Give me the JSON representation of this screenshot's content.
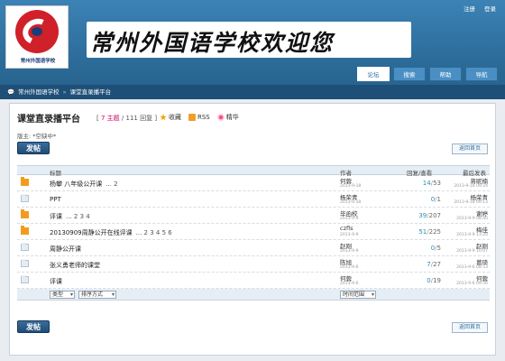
{
  "toplinks": {
    "register": "注册",
    "login": "登录"
  },
  "logo_caption": "常州外国语学校",
  "banner_text": "常州外国语学校欢迎您",
  "nav": [
    {
      "label": "论坛",
      "active": true
    },
    {
      "label": "搜索"
    },
    {
      "label": "帮助"
    },
    {
      "label": "导航"
    }
  ],
  "breadcrumb": {
    "home": "常州外国语学校",
    "sep": "»",
    "current": "课堂直录播平台"
  },
  "forum": {
    "title": "课堂直录播平台",
    "counts_prefix": "[",
    "topics": "7 主题",
    "replies": "111 回复",
    "counts_suffix": "]",
    "favorite": "收藏",
    "rss": "RSS",
    "digest": "精华",
    "moderator": "版主: *空缺中*"
  },
  "buttons": {
    "post": "发帖",
    "back": "返回首页"
  },
  "table": {
    "headers": {
      "title": "标题",
      "author": "作者",
      "stats": "回复/查看",
      "last": "最后发表"
    },
    "rows": [
      {
        "icon": "new",
        "title": "杨攀 八年级公开课",
        "pages": "... 2",
        "author": "何蓉",
        "date": "2013-9-18",
        "replies": "14",
        "views": "53",
        "last_user": "蒋昵楠",
        "last_date": "2013-9-18 09:24"
      },
      {
        "icon": "old",
        "title": "PPT",
        "pages": "",
        "author": "杨荣青",
        "date": "2013-9-18",
        "replies": "0",
        "views": "1",
        "last_user": "杨荣青",
        "last_date": "2013-9-18 09:13"
      },
      {
        "icon": "new",
        "title": "评课",
        "pages": "... 2 3 4",
        "author": "毕函校",
        "date": "2013-9-9",
        "replies": "39",
        "views": "207",
        "last_user": "谢婷",
        "last_date": "2013-9-9 08:40"
      },
      {
        "icon": "new",
        "title": "20130909周静公开在线评课",
        "pages": "... 2 3 4 5 6",
        "author": "czfls",
        "date": "2013-9-9",
        "replies": "51",
        "views": "225",
        "last_user": "梅佳",
        "last_date": "2013-9-9 13:20"
      },
      {
        "icon": "old",
        "title": "周静公开课",
        "pages": "",
        "author": "赵刚",
        "date": "2013-9-9",
        "replies": "0",
        "views": "5",
        "last_user": "赵刚",
        "last_date": "2013-9-9 10:07"
      },
      {
        "icon": "old",
        "title": "张义勇老师的课堂",
        "pages": "",
        "author": "陈旭",
        "date": "2013-9-6",
        "replies": "7",
        "views": "27",
        "last_user": "葛琦",
        "last_date": "2013-9-6 08:53"
      },
      {
        "icon": "old",
        "title": "评课",
        "pages": "",
        "author": "何蓉",
        "date": "2013-9-6",
        "replies": "0",
        "views": "19",
        "last_user": "何蓉",
        "last_date": "2013-9-6 09:50"
      }
    ],
    "slash": "/"
  },
  "filters": {
    "type": "类型",
    "sort": "排序方式",
    "time": "时间范围"
  }
}
